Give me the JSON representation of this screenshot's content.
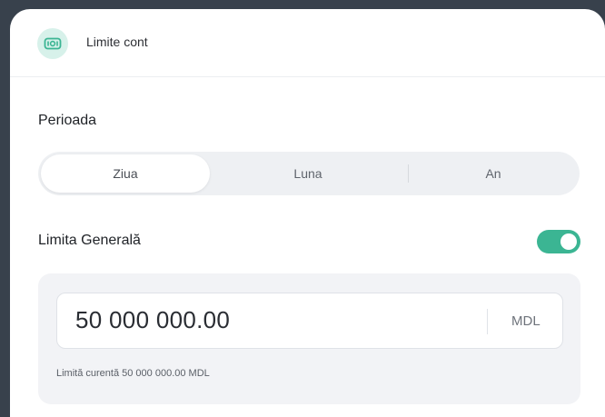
{
  "header": {
    "title": "Limite cont",
    "icon": "banknote-icon",
    "icon_color": "#3bb593"
  },
  "period": {
    "label": "Perioada",
    "options": [
      "Ziua",
      "Luna",
      "An"
    ],
    "selected": "Ziua"
  },
  "general_limit": {
    "label": "Limita Generală",
    "enabled": true,
    "accent": "#3bb593",
    "input_value": "50 000 000.00",
    "currency": "MDL",
    "hint": "Limită curentă 50 000 000.00 MDL"
  }
}
